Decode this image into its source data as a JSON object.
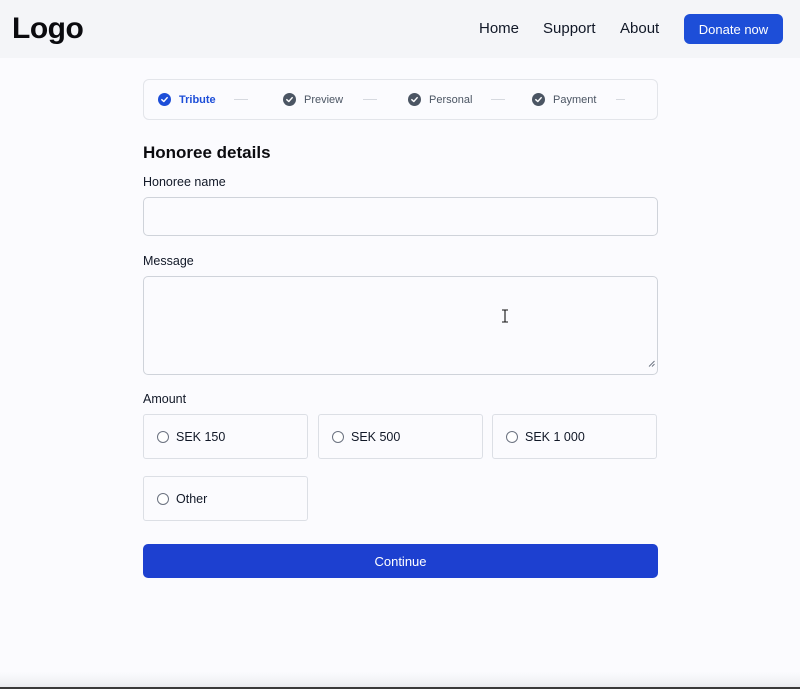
{
  "header": {
    "logo": "Logo",
    "nav": [
      {
        "label": "Home"
      },
      {
        "label": "Support"
      },
      {
        "label": "About"
      }
    ],
    "cta_label": "Donate now"
  },
  "stepper": {
    "steps": [
      {
        "label": "Tribute",
        "state": "active"
      },
      {
        "label": "Preview",
        "state": "complete"
      },
      {
        "label": "Personal",
        "state": "complete"
      },
      {
        "label": "Payment",
        "state": "complete"
      }
    ]
  },
  "form": {
    "section_title": "Honoree details",
    "honoree_name_label": "Honoree name",
    "honoree_name_value": "",
    "message_label": "Message",
    "message_value": "",
    "amount_label": "Amount",
    "amount_options": [
      {
        "label": "SEK 150"
      },
      {
        "label": "SEK 500"
      },
      {
        "label": "SEK 1 000"
      },
      {
        "label": "Other"
      }
    ],
    "continue_label": "Continue"
  },
  "colors": {
    "accent": "#1d4ed8",
    "step_complete": "#4b5563",
    "background": "#fbfbfe"
  },
  "icons": {
    "step_icon": "check-circle-icon",
    "textarea_grip": "resize-grip-icon",
    "mouse_cursor": "text-cursor-icon"
  }
}
